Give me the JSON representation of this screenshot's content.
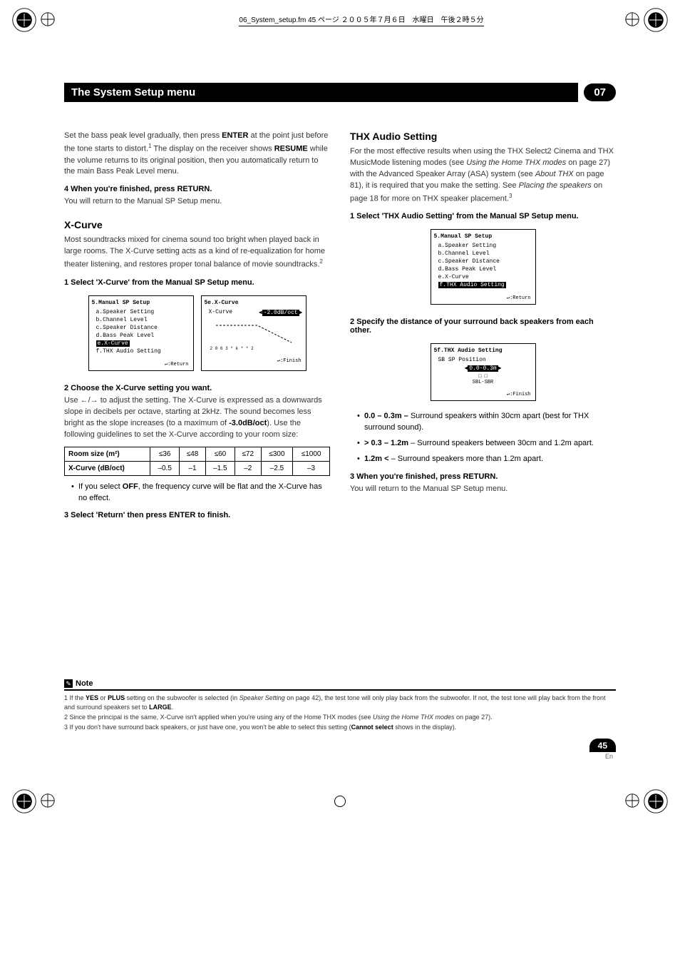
{
  "doc_tag": "06_System_setup.fm  45 ページ  ２００５年７月６日　水曜日　午後２時５分",
  "header": {
    "title": "The System Setup menu",
    "badge": "07"
  },
  "left": {
    "p1a": "Set the bass peak level gradually, then press ",
    "p1_enter": "ENTER",
    "p1b": " at the point just before the tone starts to distort.",
    "p1_fn": "1",
    "p1c": " The display on the receiver shows ",
    "p1_resume": "RESUME",
    "p1d": " while the volume returns to its original position, then you automatically return to the main Bass Peak Level menu.",
    "step4": "4    When you're finished, press RETURN.",
    "step4b": "You will return to the Manual SP Setup menu.",
    "h_xcurve": "X-Curve",
    "xc1": "Most soundtracks mixed for cinema sound too bright when played back in large rooms. The X-Curve setting acts as a kind of re-equalization for home theater listening, and restores proper tonal balance of movie soundtracks.",
    "xc1_fn": "2",
    "step1": "1    Select 'X-Curve' from the Manual SP Setup menu.",
    "step2": "2    Choose the X-Curve setting you want.",
    "xc2a": "Use ",
    "xc2b": " to adjust the setting. The X-Curve is expressed as a downwards slope in decibels per octave, starting at 2kHz. The sound becomes less bright as the slope increases (to a maximum of ",
    "xc2_bold": "-3.0dB/oct",
    "xc2c": "). Use the following guidelines to set the X-Curve according to your room size:",
    "bul_off_a": "If you select ",
    "bul_off_b": "OFF",
    "bul_off_c": ", the frequency curve will be flat and the X-Curve has no effect.",
    "step3": "3    Select 'Return' then press ENTER to finish.",
    "menu1": {
      "title": "5.Manual SP Setup",
      "a": "a.Speaker Setting",
      "b": "b.Channel Level",
      "c": "c.Speaker Distance",
      "d": "d.Bass Peak Level",
      "e": "e.X-Curve",
      "f": "f.THX Audio Setting",
      "ret": ":Return"
    },
    "menu2": {
      "title": "5e.X-Curve",
      "label": "X-Curve",
      "value": "-2.0dB/oct",
      "ticks1": "2 0 6 3 * k * * 2",
      "fin": ":Finish"
    }
  },
  "table": {
    "h1": "Room size (m²)",
    "h2": "X-Curve (dB/oct)",
    "r1": [
      "≤36",
      "≤48",
      "≤60",
      "≤72",
      "≤300",
      "≤1000"
    ],
    "r2": [
      "–0.5",
      "–1",
      "–1.5",
      "–2",
      "–2.5",
      "–3"
    ]
  },
  "right": {
    "h_thx": "THX Audio Setting",
    "t1a": "For the most effective results when using the THX Select2 Cinema and THX MusicMode listening modes (see ",
    "t1_i1": "Using the Home THX modes",
    "t1b": " on page 27) with the Advanced Speaker Array (ASA) system (see ",
    "t1_i2": "About THX",
    "t1c": " on page 81), it is required that you make the setting. See ",
    "t1_i3": "Placing the speakers",
    "t1d": " on page 18 for more on THX speaker placement.",
    "t1_fn": "3",
    "step1": "1    Select 'THX Audio Setting' from the Manual SP Setup menu.",
    "menu1": {
      "title": "5.Manual SP Setup",
      "a": "a.Speaker Setting",
      "b": "b.Channel Level",
      "c": "c.Speaker Distance",
      "d": "d.Bass Peak Level",
      "e": "e.X-Curve",
      "f": "f.THX Audio Setting",
      "ret": ":Return"
    },
    "step2": "2    Specify the distance of your surround back speakers from each other.",
    "menu2": {
      "title": "5f.THX Audio Setting",
      "label": "SB SP Position",
      "value": "0.0-0.3m",
      "diagram1": "□ □",
      "diagram2": "SBL-SBR",
      "fin": ":Finish"
    },
    "bul1_a": "0.0 – 0.3m – ",
    "bul1_b": "Surround speakers within 30cm apart (best for THX surround sound).",
    "bul2_a": " > 0.3 – 1.2m",
    "bul2_b": " – Surround speakers between 30cm and 1.2m apart.",
    "bul3_a": "1.2m < ",
    "bul3_b": "– Surround speakers more than 1.2m apart.",
    "step3": "3    When you're finished, press RETURN.",
    "step3b": "You will return to the Manual SP Setup menu."
  },
  "notes": {
    "label": "Note",
    "n1a": "1 If the ",
    "n1_yes": "YES",
    "n1b": " or ",
    "n1_plus": "PLUS",
    "n1c": " setting on the subwoofer is selected (in ",
    "n1_i": "Speaker Setting",
    "n1d": " on page 42), the test tone will only play back from the subwoofer. If not, the test tone will play back from the front and surround speakers set to ",
    "n1_large": "LARGE",
    "n1e": ".",
    "n2a": "2 Since the principal is the same, X-Curve isn't applied when you're using any of the Home THX modes (see ",
    "n2_i": "Using the Home THX modes",
    "n2b": " on page 27).",
    "n3a": "3 If you don't have surround back speakers, or just have one, you won't be able to select this setting (",
    "n3_b": "Cannot select",
    "n3c": " shows in the display)."
  },
  "pagenum": {
    "num": "45",
    "en": "En"
  }
}
